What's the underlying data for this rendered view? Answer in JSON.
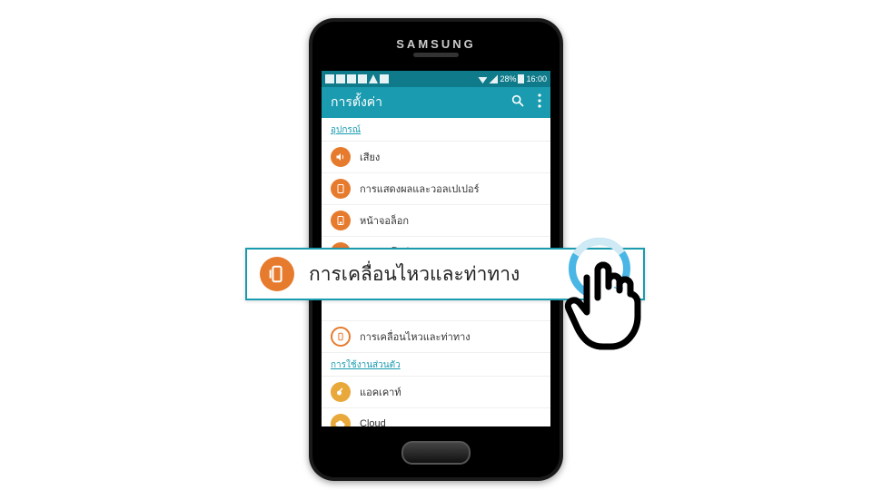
{
  "phone": {
    "brand": "SAMSUNG"
  },
  "statusbar": {
    "battery_pct": "28%",
    "time": "16:00"
  },
  "appbar": {
    "title": "การตั้งค่า"
  },
  "sections": {
    "device_header": "อุปกรณ์",
    "personal_header": "การใช้งานส่วนตัว"
  },
  "rows": {
    "sound": "เสียง",
    "display": "การแสดงผลและวอลเปเปอร์",
    "lockscreen": "หน้าจอล็อก",
    "multiwindow": "มัลติวินโดว์",
    "motion": "การเคลื่อนไหวและท่าทาง",
    "account": "แอคเคาท์",
    "cloud": "Cloud"
  },
  "callout": {
    "label": "การเคลื่อนไหวและท่าทาง"
  },
  "colors": {
    "accent": "#1a9bb0",
    "icon_orange": "#e67b2e",
    "icon_yellow": "#e8a93a"
  }
}
